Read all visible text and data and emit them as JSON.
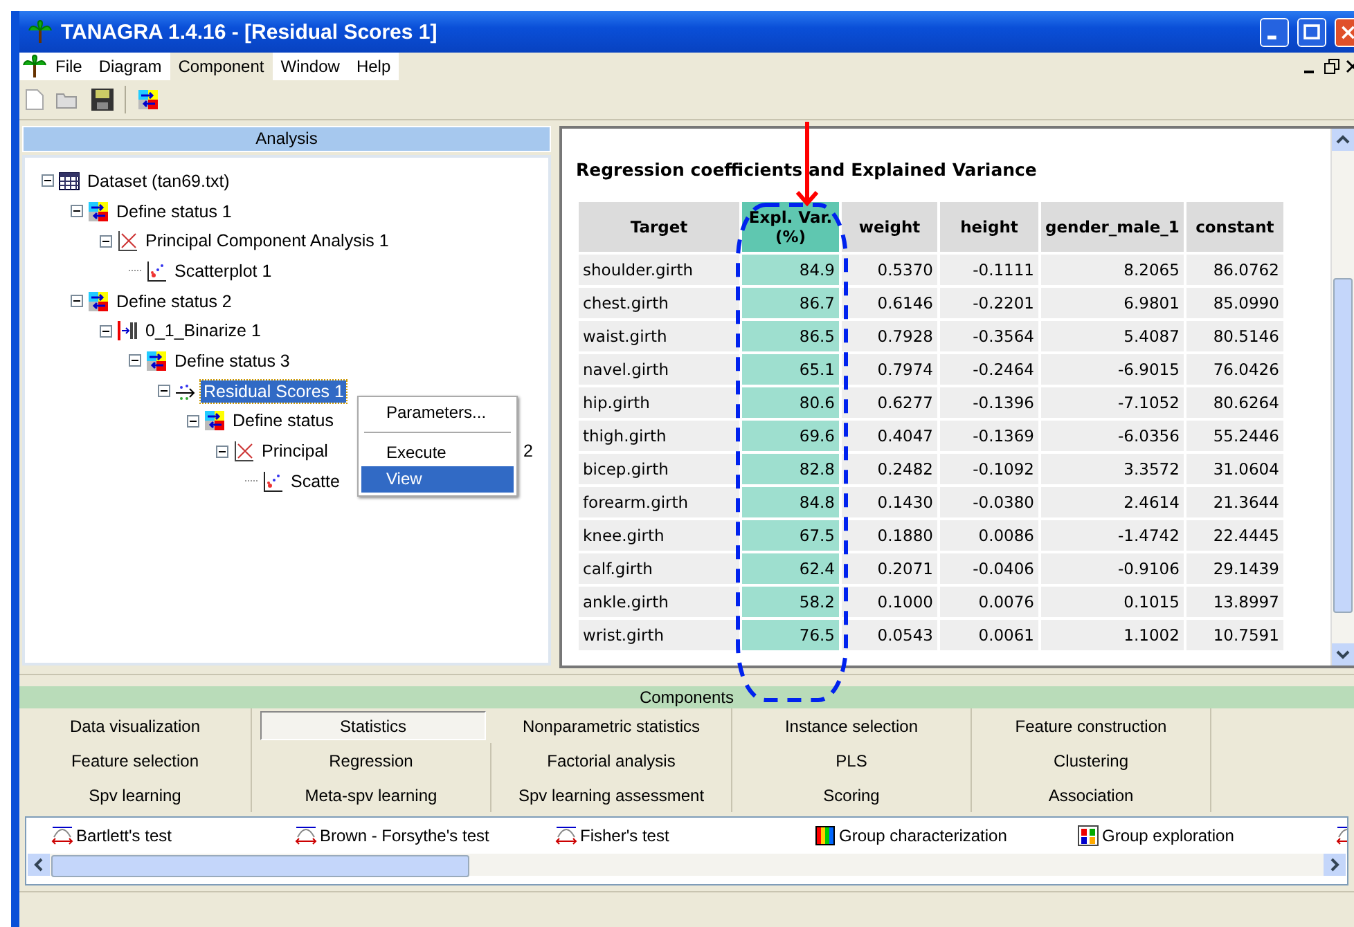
{
  "window": {
    "title": "TANAGRA 1.4.16 - [Residual Scores 1]"
  },
  "menu": [
    {
      "label": "File",
      "selected": false
    },
    {
      "label": "Diagram",
      "selected": false
    },
    {
      "label": "Component",
      "selected": true
    },
    {
      "label": "Window",
      "selected": false
    },
    {
      "label": "Help",
      "selected": false
    }
  ],
  "analysis": {
    "title": "Analysis",
    "tree": [
      {
        "label": "Dataset (tan69.txt)",
        "kind": "dataset",
        "expanded": true,
        "selected": false,
        "children": [
          {
            "label": "Define status 1",
            "kind": "status",
            "expanded": true,
            "selected": false,
            "children": [
              {
                "label": "Principal Component Analysis 1",
                "kind": "pca",
                "expanded": true,
                "selected": false,
                "children": [
                  {
                    "label": "Scatterplot 1",
                    "kind": "scatter",
                    "selected": false
                  }
                ]
              }
            ]
          },
          {
            "label": "Define status 2",
            "kind": "status",
            "expanded": true,
            "selected": false,
            "children": [
              {
                "label": "0_1_Binarize 1",
                "kind": "binarize",
                "expanded": true,
                "selected": false,
                "children": [
                  {
                    "label": "Define status 3",
                    "kind": "status",
                    "expanded": true,
                    "selected": false,
                    "children": [
                      {
                        "label": "Residual Scores 1",
                        "kind": "residual",
                        "expanded": true,
                        "selected": true,
                        "children": [
                          {
                            "label": "Define status",
                            "kind": "status",
                            "expanded": true,
                            "selected": false,
                            "children": [
                              {
                                "label": "Principal",
                                "tail": "2",
                                "kind": "pca",
                                "expanded": true,
                                "selected": false,
                                "children": [
                                  {
                                    "label": "Scatte",
                                    "kind": "scatter",
                                    "selected": false
                                  }
                                ]
                              }
                            ]
                          }
                        ]
                      }
                    ]
                  }
                ]
              }
            ]
          }
        ]
      }
    ]
  },
  "context_menu": {
    "items": [
      {
        "kind": "item",
        "label": "Parameters...",
        "selected": false
      },
      {
        "kind": "separator"
      },
      {
        "kind": "item",
        "label": "Execute",
        "selected": false
      },
      {
        "kind": "item",
        "label": "View",
        "selected": true
      }
    ]
  },
  "report": {
    "subtitle": "Regression coefficients and Explained Variance",
    "columns": [
      {
        "label": "Target",
        "highlighted": false
      },
      {
        "label": "Expl. Var. (%)",
        "highlighted": true
      },
      {
        "label": "weight",
        "highlighted": false
      },
      {
        "label": "height",
        "highlighted": false
      },
      {
        "label": "gender_male_1",
        "highlighted": false
      },
      {
        "label": "constant",
        "highlighted": false
      }
    ],
    "rows": [
      [
        "shoulder.girth",
        "84.9",
        "0.5370",
        "-0.1111",
        "8.2065",
        "86.0762"
      ],
      [
        "chest.girth",
        "86.7",
        "0.6146",
        "-0.2201",
        "6.9801",
        "85.0990"
      ],
      [
        "waist.girth",
        "86.5",
        "0.7928",
        "-0.3564",
        "5.4087",
        "80.5146"
      ],
      [
        "navel.girth",
        "65.1",
        "0.7974",
        "-0.2464",
        "-6.9015",
        "76.0426"
      ],
      [
        "hip.girth",
        "80.6",
        "0.6277",
        "-0.1396",
        "-7.1052",
        "80.6264"
      ],
      [
        "thigh.girth",
        "69.6",
        "0.4047",
        "-0.1369",
        "-6.0356",
        "55.2446"
      ],
      [
        "bicep.girth",
        "82.8",
        "0.2482",
        "-0.1092",
        "3.3572",
        "31.0604"
      ],
      [
        "forearm.girth",
        "84.8",
        "0.1430",
        "-0.0380",
        "2.4614",
        "21.3644"
      ],
      [
        "knee.girth",
        "67.5",
        "0.1880",
        "0.0086",
        "-1.4742",
        "22.4445"
      ],
      [
        "calf.girth",
        "62.4",
        "0.2071",
        "-0.0406",
        "-0.9106",
        "29.1439"
      ],
      [
        "ankle.girth",
        "58.2",
        "0.1000",
        "0.0076",
        "0.1015",
        "13.8997"
      ],
      [
        "wrist.girth",
        "76.5",
        "0.0543",
        "0.0061",
        "1.1002",
        "10.7591"
      ]
    ]
  },
  "components": {
    "title": "Components",
    "tabs": [
      {
        "label": "Data visualization",
        "selected": false
      },
      {
        "label": "Statistics",
        "selected": true
      },
      {
        "label": "Nonparametric statistics",
        "selected": false
      },
      {
        "label": "Instance selection",
        "selected": false
      },
      {
        "label": "Feature construction",
        "selected": false
      },
      {
        "label": "Feature selection",
        "selected": false
      },
      {
        "label": "Regression",
        "selected": false
      },
      {
        "label": "Factorial analysis",
        "selected": false
      },
      {
        "label": "PLS",
        "selected": false
      },
      {
        "label": "Clustering",
        "selected": false
      },
      {
        "label": "Spv learning",
        "selected": false
      },
      {
        "label": "Meta-spv learning",
        "selected": false
      },
      {
        "label": "Spv learning assessment",
        "selected": false
      },
      {
        "label": "Scoring",
        "selected": false
      },
      {
        "label": "Association",
        "selected": false
      }
    ],
    "items": [
      {
        "label": "Bartlett's test",
        "kind": "test"
      },
      {
        "label": "Brown - Forsythe's test",
        "kind": "test"
      },
      {
        "label": "Fisher's test",
        "kind": "test"
      },
      {
        "label": "Group characterization",
        "kind": "bars"
      },
      {
        "label": "Group exploration",
        "kind": "grid"
      },
      {
        "kind": "test"
      }
    ]
  }
}
